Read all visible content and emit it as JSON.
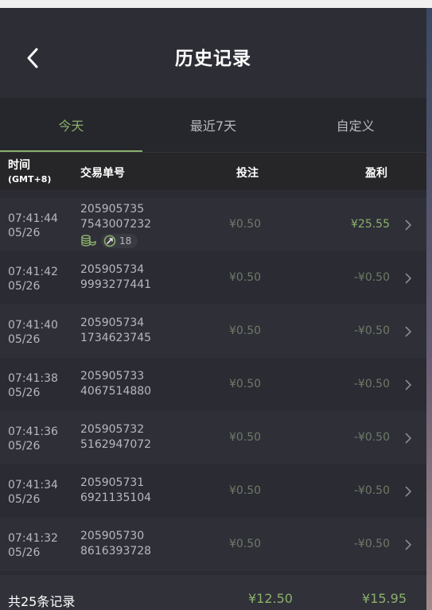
{
  "header": {
    "title": "历史记录",
    "back_icon": "chevron-left-icon"
  },
  "tabs": [
    {
      "label": "今天",
      "active": true
    },
    {
      "label": "最近7天",
      "active": false
    },
    {
      "label": "自定义",
      "active": false
    }
  ],
  "columns": {
    "time": "时间",
    "time_sub": "(GMT+8)",
    "order": "交易单号",
    "bet": "投注",
    "profit": "盈利"
  },
  "rows": [
    {
      "time": "07:41:44",
      "date": "05/26",
      "order_line1": "205905735",
      "order_line2": "7543007232",
      "bet": "¥0.50",
      "profit": "¥25.55",
      "win": true,
      "badge_count": "18"
    },
    {
      "time": "07:41:42",
      "date": "05/26",
      "order_line1": "205905734",
      "order_line2": "9993277441",
      "bet": "¥0.50",
      "profit": "-¥0.50",
      "win": false
    },
    {
      "time": "07:41:40",
      "date": "05/26",
      "order_line1": "205905734",
      "order_line2": "1734623745",
      "bet": "¥0.50",
      "profit": "-¥0.50",
      "win": false
    },
    {
      "time": "07:41:38",
      "date": "05/26",
      "order_line1": "205905733",
      "order_line2": "4067514880",
      "bet": "¥0.50",
      "profit": "-¥0.50",
      "win": false
    },
    {
      "time": "07:41:36",
      "date": "05/26",
      "order_line1": "205905732",
      "order_line2": "5162947072",
      "bet": "¥0.50",
      "profit": "-¥0.50",
      "win": false
    },
    {
      "time": "07:41:34",
      "date": "05/26",
      "order_line1": "205905731",
      "order_line2": "6921135104",
      "bet": "¥0.50",
      "profit": "-¥0.50",
      "win": false
    },
    {
      "time": "07:41:32",
      "date": "05/26",
      "order_line1": "205905730",
      "order_line2": "8616393728",
      "bet": "¥0.50",
      "profit": "-¥0.50",
      "win": false
    }
  ],
  "footer": {
    "total_label": "共25条记录",
    "total_bet": "¥12.50",
    "total_profit": "¥15.95"
  },
  "colors": {
    "accent_green": "#8ab06a",
    "muted_green": "#6e7a66",
    "background": "#2b2b33"
  }
}
